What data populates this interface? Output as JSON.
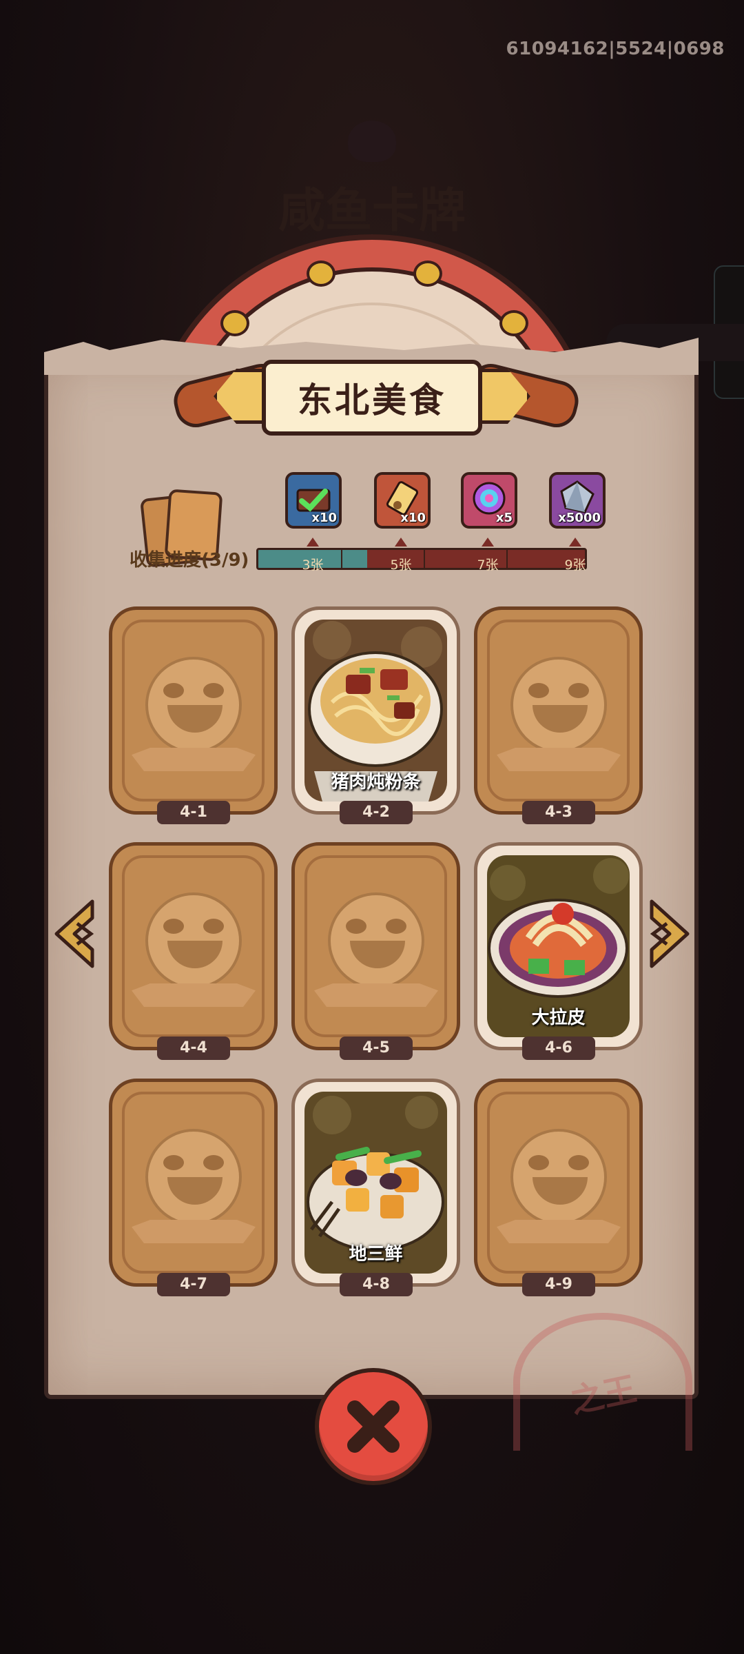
{
  "debug_id": "61094162|5524|0698",
  "background_title": "咸鱼卡牌",
  "stamp_text": "之王",
  "panel": {
    "title": "东北美食",
    "progress_label": "收集进度(3/9)",
    "progress_collected": 3,
    "progress_total": 9
  },
  "rewards": [
    {
      "name": "treasure-chest-ticket",
      "qty": "x10",
      "threshold": "3张",
      "color": "#3a6aa0"
    },
    {
      "name": "golden-key-ticket",
      "qty": "x10",
      "threshold": "5张",
      "color": "#c0553a"
    },
    {
      "name": "rainbow-disc",
      "qty": "x5",
      "threshold": "7张",
      "color": "#c04a6a"
    },
    {
      "name": "crystal-gem",
      "qty": "x5000",
      "threshold": "9张",
      "color": "#8a4aa0"
    }
  ],
  "cards": [
    {
      "id": "4-1",
      "unlocked": false,
      "name": ""
    },
    {
      "id": "4-2",
      "unlocked": true,
      "name": "猪肉炖粉条"
    },
    {
      "id": "4-3",
      "unlocked": false,
      "name": ""
    },
    {
      "id": "4-4",
      "unlocked": false,
      "name": ""
    },
    {
      "id": "4-5",
      "unlocked": false,
      "name": ""
    },
    {
      "id": "4-6",
      "unlocked": true,
      "name": "大拉皮"
    },
    {
      "id": "4-7",
      "unlocked": false,
      "name": ""
    },
    {
      "id": "4-8",
      "unlocked": true,
      "name": "地三鲜"
    },
    {
      "id": "4-9",
      "unlocked": false,
      "name": ""
    }
  ],
  "colors": {
    "accent_red": "#e44c40",
    "panel_paper": "#c9b3a3",
    "progress_teal": "#4c8c88"
  }
}
